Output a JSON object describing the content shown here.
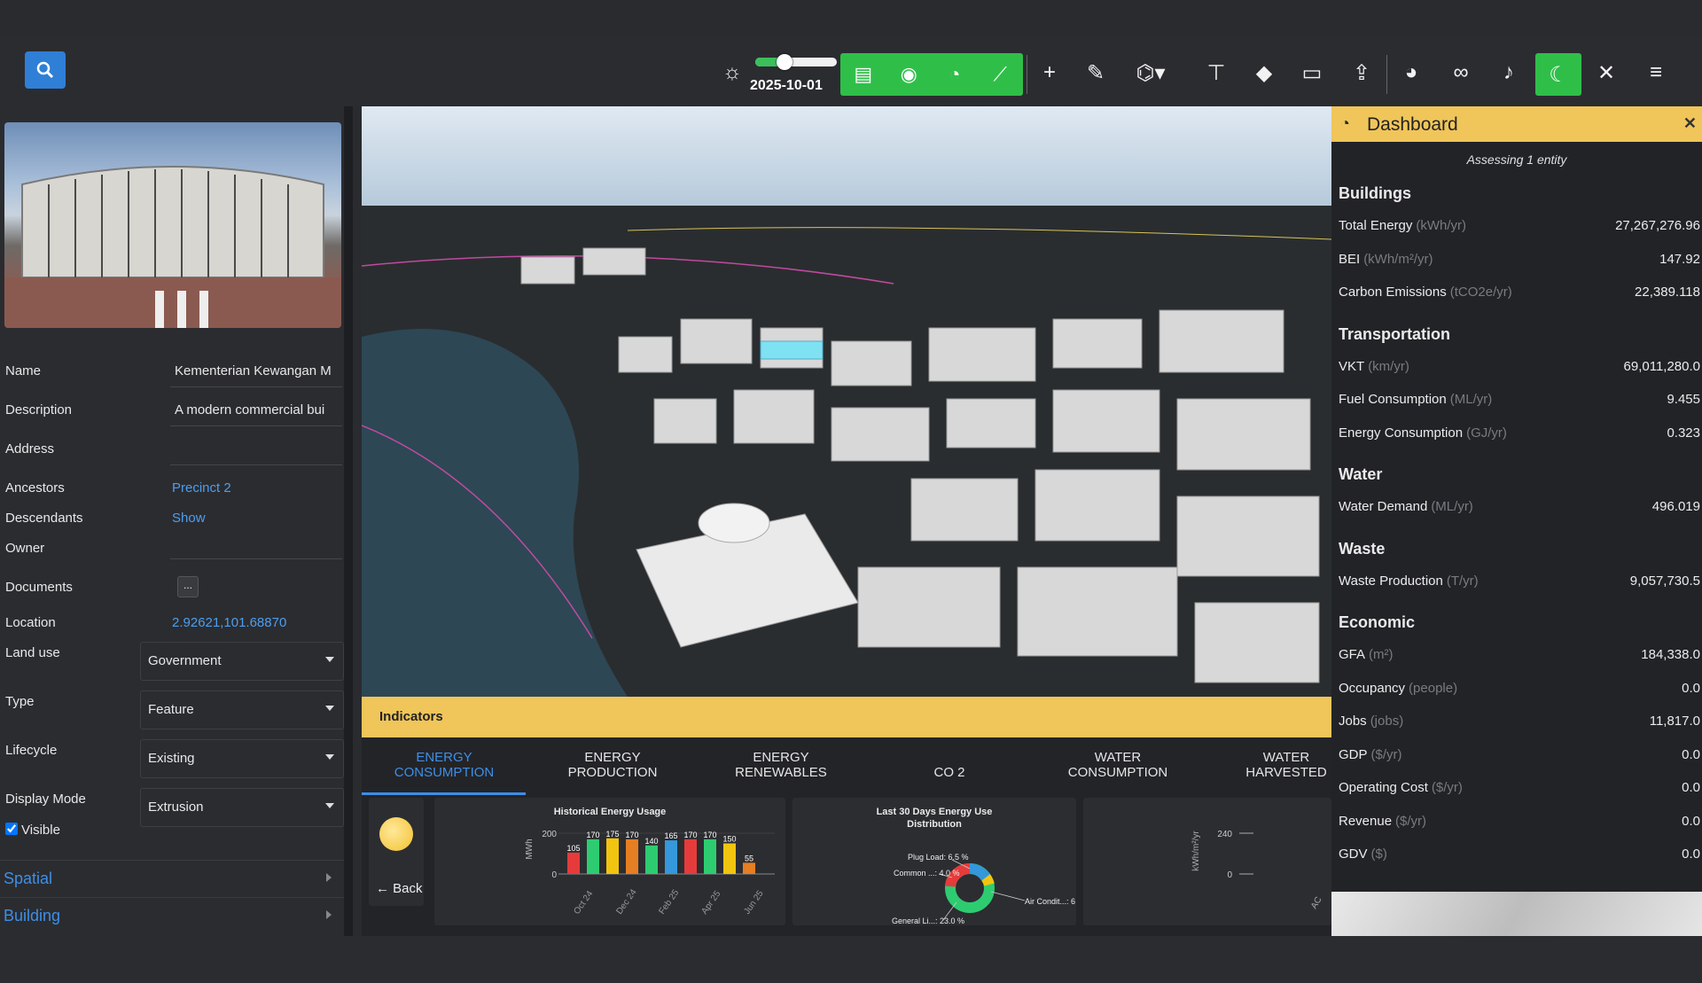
{
  "toolbar": {
    "date": "2025-10-01",
    "icons": [
      "brightness-icon",
      "building-icon",
      "eye-icon",
      "dashboard-icon",
      "chart-line-icon",
      "plus-icon",
      "pencil-icon",
      "binoculars-icon",
      "sitemap-icon",
      "tag-icon",
      "folder-icon",
      "upload-icon",
      "pie-chart-icon",
      "link-icon",
      "bell-icon",
      "moon-icon",
      "close-icon",
      "menu-icon"
    ]
  },
  "entity": {
    "fields": {
      "name_label": "Name",
      "name_value": "Kementerian Kewangan M",
      "description_label": "Description",
      "description_value": "A modern commercial bui",
      "address_label": "Address",
      "address_value": "",
      "ancestors_label": "Ancestors",
      "ancestors_value": "Precinct 2",
      "descendants_label": "Descendants",
      "descendants_value": "Show",
      "owner_label": "Owner",
      "owner_value": "",
      "documents_label": "Documents",
      "documents_button": "...",
      "location_label": "Location",
      "location_value": "2.92621,101.68870",
      "landuse_label": "Land use",
      "landuse_value": "Government",
      "type_label": "Type",
      "type_value": "Feature",
      "lifecycle_label": "Lifecycle",
      "lifecycle_value": "Existing",
      "displaymode_label": "Display Mode",
      "displaymode_value": "Extrusion",
      "visible_label": "Visible"
    },
    "sections": [
      "Spatial",
      "Building"
    ]
  },
  "indicators": {
    "title": "Indicators",
    "tabs": [
      {
        "line1": "ENERGY",
        "line2": "CONSUMPTION"
      },
      {
        "line1": "ENERGY",
        "line2": "PRODUCTION"
      },
      {
        "line1": "ENERGY",
        "line2": "RENEWABLES"
      },
      {
        "line1": "",
        "line2": "CO 2"
      },
      {
        "line1": "WATER",
        "line2": "CONSUMPTION"
      },
      {
        "line1": "WATER",
        "line2": "HARVESTED"
      }
    ],
    "back_label": "← Back",
    "chart1": {
      "title": "Historical Energy Usage",
      "ylabel": "MWh",
      "yticks": [
        "200",
        "0"
      ],
      "xticks": [
        "Oct 24",
        "Dec 24",
        "Feb 25",
        "Apr 25",
        "Jun 25"
      ],
      "bar_labels": [
        "105",
        "170",
        "175",
        "170",
        "140",
        "165",
        "170",
        "170",
        "150",
        "55"
      ],
      "values": [
        105,
        170,
        175,
        170,
        140,
        165,
        170,
        170,
        150,
        55
      ],
      "colors": [
        "#e63b3b",
        "#2ecc71",
        "#f1c40f",
        "#e67e22",
        "#2ecc71",
        "#3498db",
        "#e63b3b",
        "#2ecc71",
        "#f1c40f",
        "#e67e22",
        "#2ecc71",
        "#3498db",
        "#e63b3b",
        "#2ecc71",
        "#f1c40f",
        "#e67e22",
        "#2ecc71",
        "#e63b3b"
      ]
    },
    "chart2": {
      "title_line1": "Last 30 Days Energy Use",
      "title_line2": "Distribution",
      "labels": [
        "Plug Load: 6.5 %",
        "Common ...: 4.0 %",
        "General Li...: 23.0 %",
        "Air Condit...: 6"
      ]
    },
    "chart3": {
      "ylabel": "kWh/m²/yr",
      "yticks": [
        "240",
        "0"
      ],
      "xtick": "AC"
    }
  },
  "dashboard": {
    "title": "Dashboard",
    "subtitle": "Assessing 1 entity",
    "sections": [
      {
        "title": "Buildings",
        "metrics": [
          {
            "label": "Total Energy",
            "unit": "(kWh/yr)",
            "value": "27,267,276.96"
          },
          {
            "label": "BEI",
            "unit": "(kWh/m²/yr)",
            "value": "147.92"
          },
          {
            "label": "Carbon Emissions",
            "unit": "(tCO2e/yr)",
            "value": "22,389.118"
          }
        ]
      },
      {
        "title": "Transportation",
        "metrics": [
          {
            "label": "VKT",
            "unit": "(km/yr)",
            "value": "69,011,280.0"
          },
          {
            "label": "Fuel Consumption",
            "unit": "(ML/yr)",
            "value": "9.455"
          },
          {
            "label": "Energy Consumption",
            "unit": "(GJ/yr)",
            "value": "0.323"
          }
        ]
      },
      {
        "title": "Water",
        "metrics": [
          {
            "label": "Water Demand",
            "unit": "(ML/yr)",
            "value": "496.019"
          }
        ]
      },
      {
        "title": "Waste",
        "metrics": [
          {
            "label": "Waste Production",
            "unit": "(T/yr)",
            "value": "9,057,730.5"
          }
        ]
      },
      {
        "title": "Economic",
        "metrics": [
          {
            "label": "GFA",
            "unit": "(m²)",
            "value": "184,338.0"
          },
          {
            "label": "Occupancy",
            "unit": "(people)",
            "value": "0.0"
          },
          {
            "label": "Jobs",
            "unit": "(jobs)",
            "value": "11,817.0"
          },
          {
            "label": "GDP",
            "unit": "($/yr)",
            "value": "0.0"
          },
          {
            "label": "Operating Cost",
            "unit": "($/yr)",
            "value": "0.0"
          },
          {
            "label": "Revenue",
            "unit": "($/yr)",
            "value": "0.0"
          },
          {
            "label": "GDV",
            "unit": "($)",
            "value": "0.0"
          }
        ]
      }
    ]
  }
}
